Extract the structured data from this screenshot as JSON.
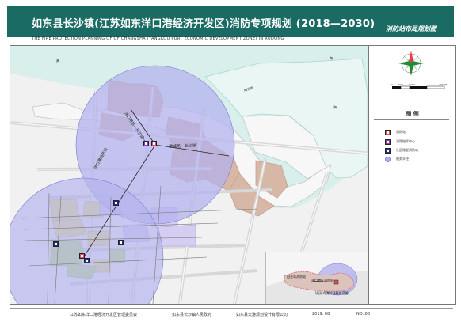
{
  "header": {
    "title": "如东县长沙镇(江苏如东洋口港经济开发区)消防专项规划 (2018—2030)",
    "map_name": "消防站布局规划图",
    "english_subtitle": "THE FIRE PROTECTION PLANNING OF OF CHANGSHA (YANGKOU PORT ECONOMIC DEVELOPMENT ZONE) IN RUDONG"
  },
  "map": {
    "water_labels": [
      "黄",
      "海",
      "海"
    ],
    "area_labels": [
      "阳光岛",
      "阳光岛"
    ],
    "road_labels": [
      "洋口港站—长沙镇一期",
      "港城路—长沙镇",
      "洋口港消防站"
    ],
    "inset": {
      "labels": [
        "阳光岛消防站",
        "洋口港区消防站",
        "(阳光岛消防站服务范围)"
      ]
    }
  },
  "scale": {
    "ticks": [
      "0",
      "500",
      "1000",
      "2000M"
    ]
  },
  "legend": {
    "title": "图 例",
    "items": [
      {
        "label": "消防站",
        "color": "#e0505f",
        "icon": "fire-station-icon"
      },
      {
        "label": "消防指挥中心",
        "color": "#8a3fb0",
        "icon": "command-center-icon"
      },
      {
        "label": "社区微型消防站",
        "color": "#2a2f8f",
        "icon": "micro-station-icon"
      },
      {
        "label": "服务半径",
        "color": "#b3b2ee",
        "icon": "service-radius-icon"
      }
    ]
  },
  "footer": {
    "committee": "江苏如东洋口港经济开发区管理委员会",
    "government": "如东县长沙镇人民政府",
    "institute": "如东县大港规划设计有限公司",
    "date": "2019. 08",
    "number": "NO. 08"
  },
  "colors": {
    "header": "#1a6b63",
    "sea": "#d9efec",
    "land": "#f3f3f3",
    "service_radius": "#b3b2ee",
    "industrial": "#d7b7a5",
    "residential": "#ece48d",
    "green": "#bddf7f",
    "fire_station": "#e0505f",
    "command_center": "#8a3fb0",
    "micro_station": "#2a2f8f"
  }
}
